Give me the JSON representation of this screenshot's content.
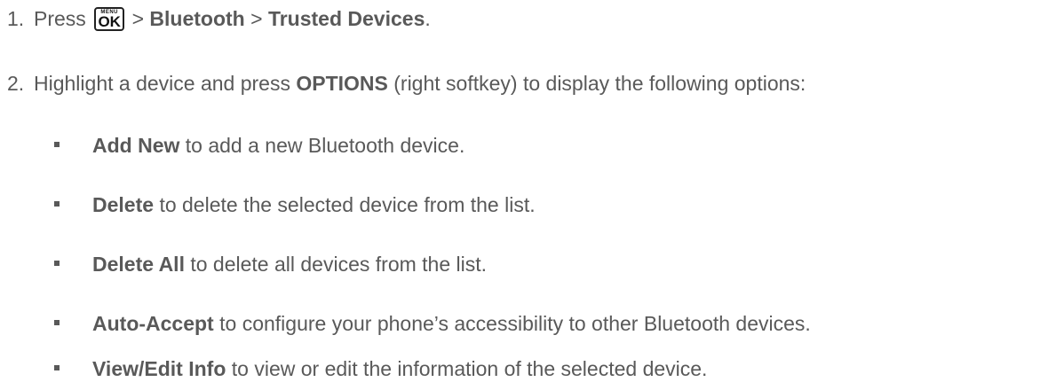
{
  "steps": [
    {
      "number": "1.",
      "prefix": "Press",
      "key": {
        "icon": "menu-ok-key-icon",
        "top": "MENU",
        "main": "OK"
      },
      "sep1": ">",
      "target1": "Bluetooth",
      "sep2": ">",
      "target2": "Trusted Devices",
      "end": "."
    },
    {
      "number": "2.",
      "prefix": "Highlight a device and press",
      "bold": "OPTIONS",
      "suffix": "(right softkey) to display the following options:"
    }
  ],
  "options": [
    {
      "label": "Add New",
      "text": "to add a new Bluetooth device."
    },
    {
      "label": "Delete",
      "text": "to delete the selected device from the list."
    },
    {
      "label": "Delete All",
      "text": "to delete all devices from the list."
    },
    {
      "label": "Auto-Accept",
      "text": "to configure your phone’s accessibility to other Bluetooth devices."
    },
    {
      "label": "View/Edit Info",
      "text": "to view or edit the information of the selected device."
    }
  ]
}
